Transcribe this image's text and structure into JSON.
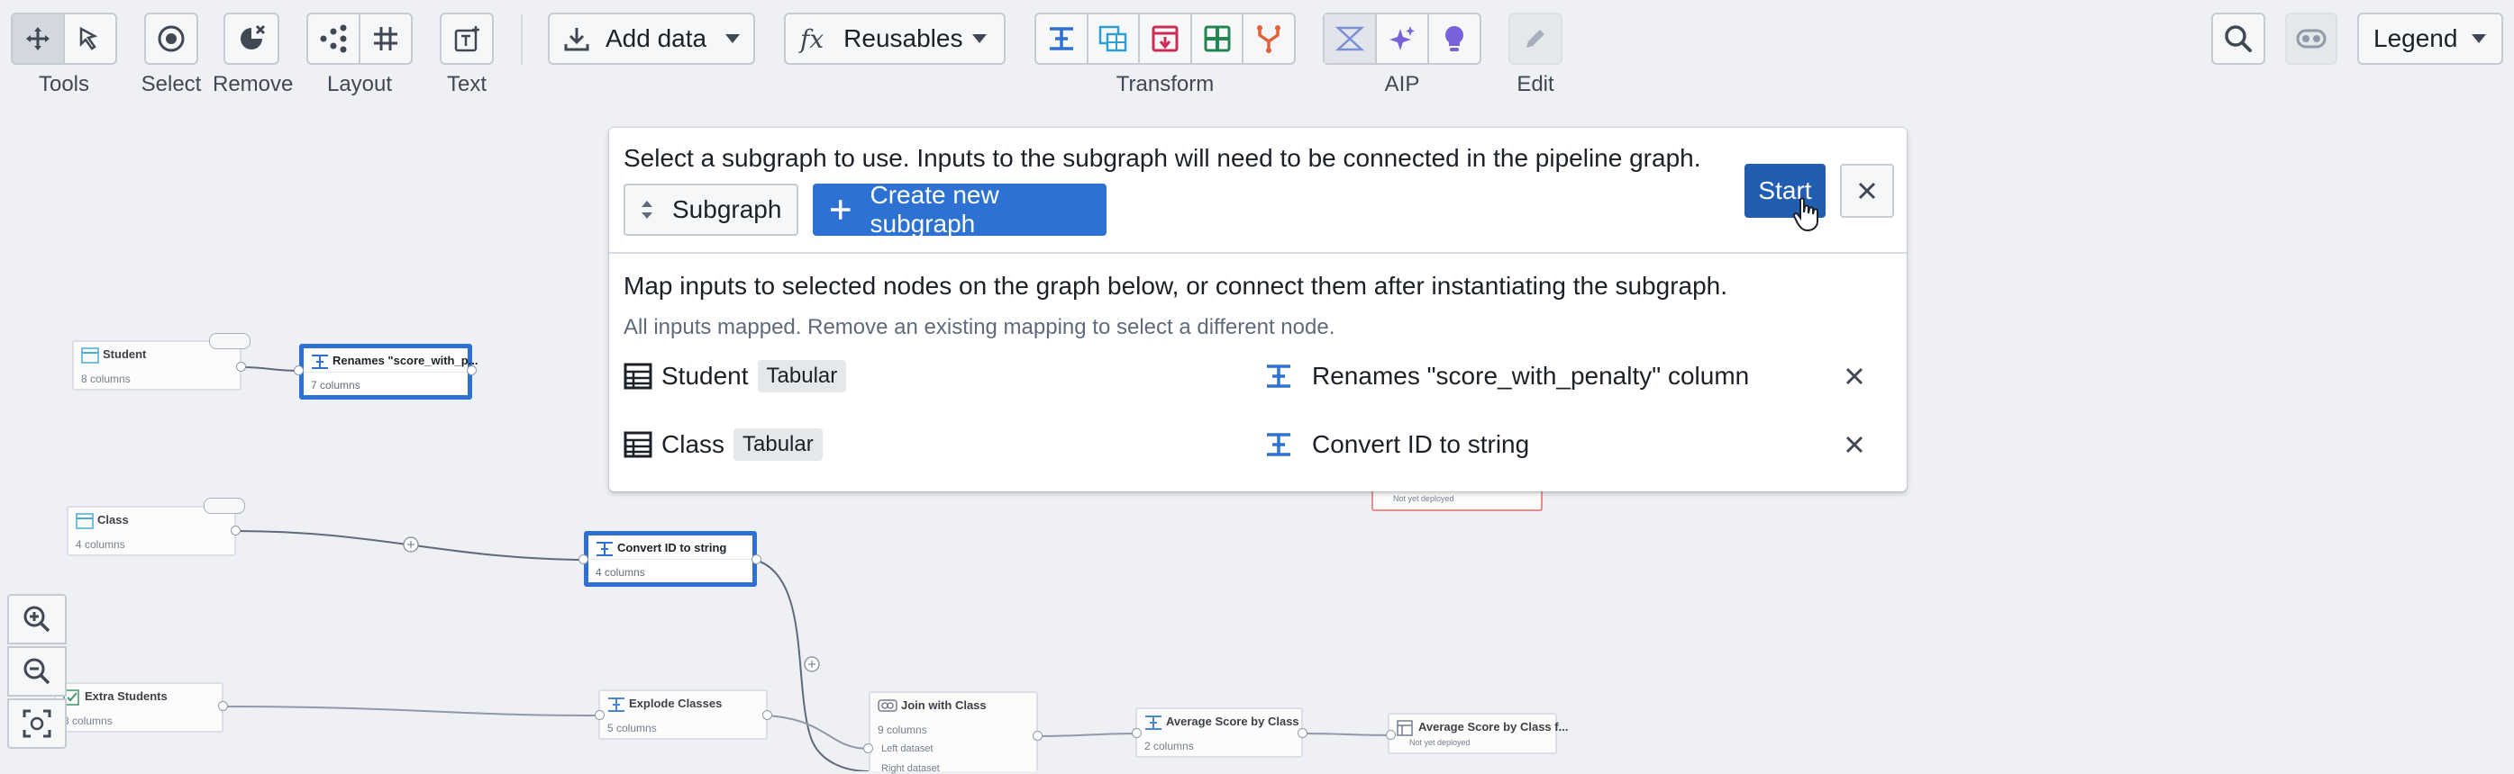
{
  "toolbar": {
    "tools_label": "Tools",
    "select_label": "Select",
    "remove_label": "Remove",
    "layout_label": "Layout",
    "text_label": "Text",
    "add_data_label": "Add data",
    "reusables_label": "Reusables",
    "reusables_fx": "fx",
    "transform_label": "Transform",
    "aip_label": "AIP",
    "edit_label": "Edit",
    "legend_label": "Legend",
    "accent": "#2d72d2"
  },
  "dialog": {
    "instruction": "Select a subgraph to use. Inputs to the subgraph will need to be connected in the pipeline graph.",
    "subgraph_select_label": "Subgraph",
    "create_button_label": "Create new subgraph",
    "start_button_label": "Start",
    "map_heading": "Map inputs to selected nodes on the graph below, or connect them after instantiating the subgraph.",
    "map_status": "All inputs mapped. Remove an existing mapping to select a different node.",
    "mappings": [
      {
        "input": "Student",
        "type": "Tabular",
        "target": "Renames \"score_with_penalty\" column"
      },
      {
        "input": "Class",
        "type": "Tabular",
        "target": "Convert ID to string"
      }
    ]
  },
  "graph": {
    "nodes": {
      "student": {
        "title": "Student",
        "sub": "8 columns"
      },
      "renames": {
        "title": "Renames \"score_with_p...",
        "sub": "7 columns"
      },
      "class": {
        "title": "Class",
        "sub": "4 columns"
      },
      "convert": {
        "title": "Convert ID to string",
        "sub": "4 columns"
      },
      "extra": {
        "title": "Extra Students",
        "sub": "8 columns"
      },
      "explode": {
        "title": "Explode Classes",
        "sub": "5 columns"
      },
      "join": {
        "title": "Join with Class",
        "sub": "9 columns",
        "left": "Left dataset",
        "right": "Right dataset"
      },
      "avg": {
        "title": "Average Score by Class",
        "sub": "2 columns"
      },
      "avgout": {
        "title": "Average Score by Class f...",
        "sub": "Not yet deployed"
      },
      "hidden": {
        "sub": "Not yet deployed"
      }
    }
  }
}
